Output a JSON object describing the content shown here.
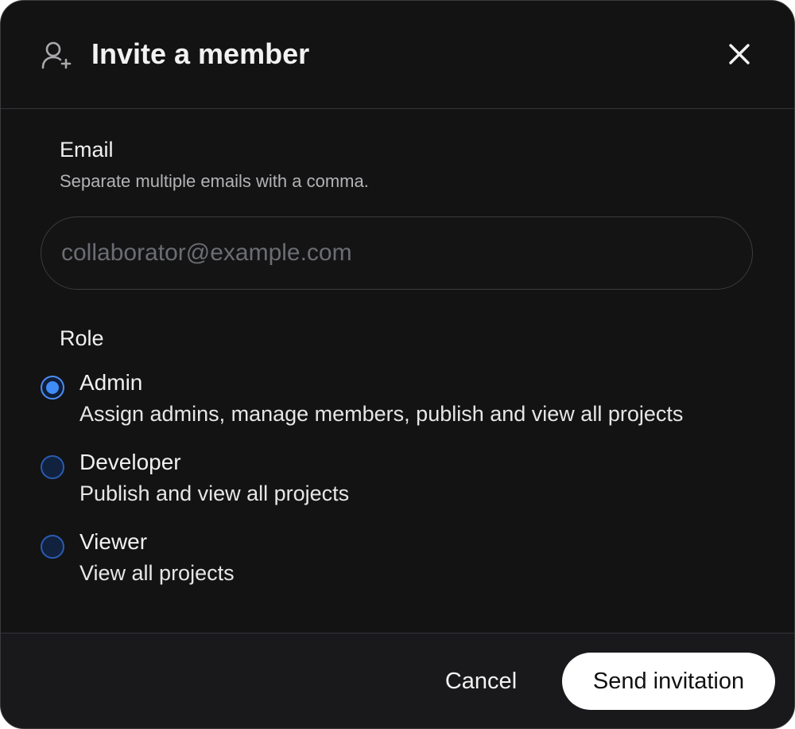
{
  "dialog": {
    "title": "Invite a member",
    "header_icon": "user-plus-icon",
    "close_icon": "close-icon"
  },
  "email": {
    "label": "Email",
    "hint": "Separate multiple emails with a comma.",
    "value": "",
    "placeholder": "collaborator@example.com"
  },
  "role": {
    "label": "Role",
    "selected": "Admin",
    "options": [
      {
        "title": "Admin",
        "description": "Assign admins, manage members, publish and view all projects"
      },
      {
        "title": "Developer",
        "description": "Publish and view all projects"
      },
      {
        "title": "Viewer",
        "description": "View all projects"
      }
    ]
  },
  "footer": {
    "cancel_label": "Cancel",
    "send_label": "Send invitation"
  },
  "colors": {
    "background": "#131314",
    "footer_background": "#19191b",
    "accent": "#3f8cf7",
    "primary_button": "#ffffff"
  }
}
